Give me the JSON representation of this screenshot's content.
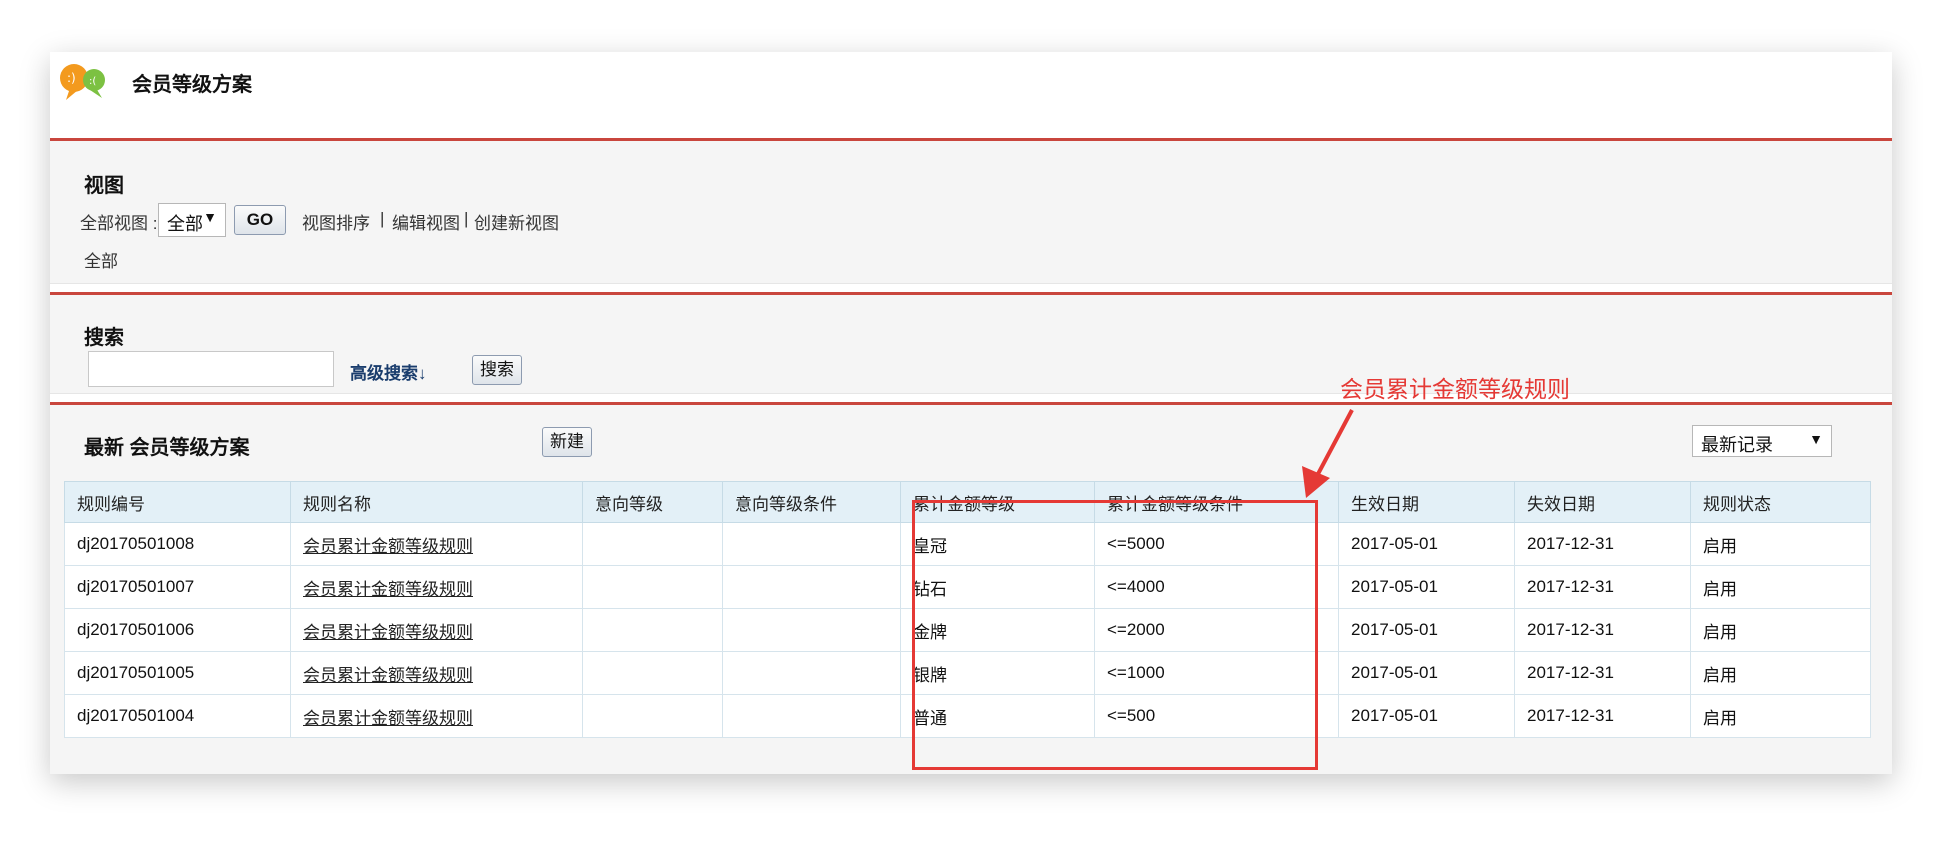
{
  "app": {
    "title": "会员等级方案"
  },
  "view_section": {
    "title": "视图",
    "label": "全部视图 :",
    "select_value": "全部",
    "go_label": "GO",
    "sort_link": "视图排序",
    "edit_link": "编辑视图",
    "create_link": "创建新视图",
    "current": "全部"
  },
  "search_section": {
    "title": "搜索",
    "input_value": "",
    "advanced_link": "高级搜索↓",
    "search_button": "搜索"
  },
  "list_section": {
    "title": "最新 会员等级方案",
    "new_button": "新建",
    "sort_select": "最新记录",
    "columns": [
      "规则编号",
      "规则名称",
      "意向等级",
      "意向等级条件",
      "累计金额等级",
      "累计金额等级条件",
      "生效日期",
      "失效日期",
      "规则状态"
    ],
    "rows": [
      {
        "id": "dj20170501008",
        "name": "会员累计金额等级规则",
        "intent": "",
        "intent_cond": "",
        "amount_level": "皇冠",
        "amount_cond": "<=5000",
        "start": "2017-05-01",
        "end": "2017-12-31",
        "status": "启用"
      },
      {
        "id": "dj20170501007",
        "name": "会员累计金额等级规则",
        "intent": "",
        "intent_cond": "",
        "amount_level": "钻石",
        "amount_cond": "<=4000",
        "start": "2017-05-01",
        "end": "2017-12-31",
        "status": "启用"
      },
      {
        "id": "dj20170501006",
        "name": "会员累计金额等级规则",
        "intent": "",
        "intent_cond": "",
        "amount_level": "金牌",
        "amount_cond": "<=2000",
        "start": "2017-05-01",
        "end": "2017-12-31",
        "status": "启用"
      },
      {
        "id": "dj20170501005",
        "name": "会员累计金额等级规则",
        "intent": "",
        "intent_cond": "",
        "amount_level": "银牌",
        "amount_cond": "<=1000",
        "start": "2017-05-01",
        "end": "2017-12-31",
        "status": "启用"
      },
      {
        "id": "dj20170501004",
        "name": "会员累计金额等级规则",
        "intent": "",
        "intent_cond": "",
        "amount_level": "普通",
        "amount_cond": "<=500",
        "start": "2017-05-01",
        "end": "2017-12-31",
        "status": "启用"
      }
    ]
  },
  "annotation": {
    "label": "会员累计金额等级规则"
  },
  "colors": {
    "accent_border": "#c9463d",
    "header_bg": "#e3f0f7",
    "annotation_red": "#e53935"
  },
  "icons": {
    "logo": "chat-bubbles-icon"
  }
}
